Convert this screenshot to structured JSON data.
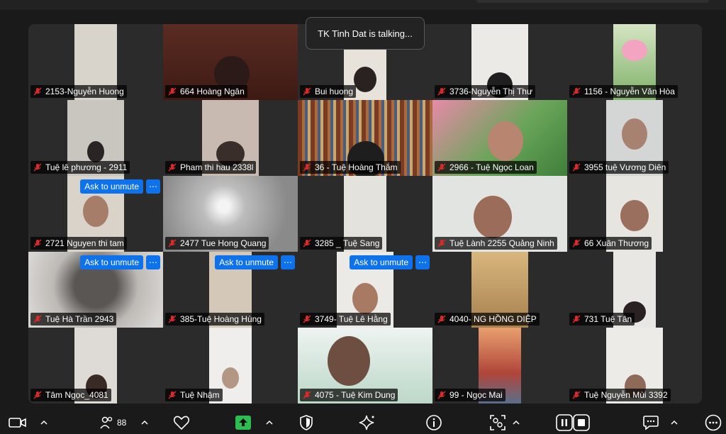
{
  "talking_indicator": "TK Tinh Dat is talking...",
  "unmute_label": "Ask to unmute",
  "more_label": "⋯",
  "participants_count": "88",
  "colors": {
    "mic_muted": "#e02828",
    "accent": "#0e72ed",
    "share_green": "#2dbe51"
  },
  "tiles": [
    {
      "name": "2153-Nguyễn Huong"
    },
    {
      "name": "664 Hoàng Ngân"
    },
    {
      "name": "Bui huong"
    },
    {
      "name": "3736-Nguyễn Thị Thư"
    },
    {
      "name": "1156 - Nguyễn Văn Hòa"
    },
    {
      "name": "Tuệ lê phương - 2911"
    },
    {
      "name": "Pham thi hau 2338l"
    },
    {
      "name": "36 - Tuệ Hoàng Thắm"
    },
    {
      "name": "2966 - Tuệ Ngọc Loan"
    },
    {
      "name": "3955  tuệ Vương Diên"
    },
    {
      "name": "2721 Nguyen thi tam"
    },
    {
      "name": "2477 Tue Hong Quang"
    },
    {
      "name": "3285 _ Tuệ Sang"
    },
    {
      "name": "Tuệ Lành 2255 Quảng Ninh"
    },
    {
      "name": "66 Xuân Thương"
    },
    {
      "name": "Tuệ Hà Trần 2943"
    },
    {
      "name": "385-Tuệ Hoàng Hùng"
    },
    {
      "name": "3749- Tuệ Lê Hằng"
    },
    {
      "name": "4040- NG HỒNG DIỆP"
    },
    {
      "name": "731 Tuệ Tân"
    },
    {
      "name": "Tâm Ngọc_4081"
    },
    {
      "name": "Tuệ Nhậm"
    },
    {
      "name": "4075 - Tuệ Kim Dung"
    },
    {
      "name": "99 - Ngọc Mai"
    },
    {
      "name": "Tuệ Nguyễn Mùi 3392"
    }
  ]
}
